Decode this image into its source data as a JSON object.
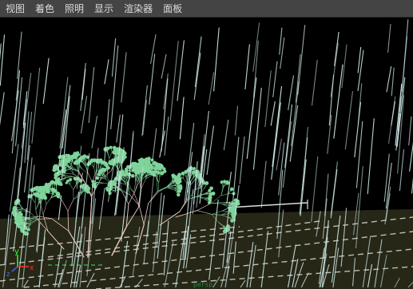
{
  "menu": {
    "items": [
      {
        "label": "视图"
      },
      {
        "label": "着色"
      },
      {
        "label": "照明"
      },
      {
        "label": "显示"
      },
      {
        "label": "渲染器"
      },
      {
        "label": "面板"
      }
    ]
  },
  "viewport": {
    "axis_icon": {
      "y_label": "y",
      "x_label": "x",
      "z_label": "z"
    },
    "colors": {
      "background": "#000000",
      "ground": "#2a2a1a",
      "rain": "#c8e4e0",
      "foliage": "#7fd49a",
      "branches": "#e8c8c0",
      "axis_x": "#ff3030",
      "axis_y": "#30ff30",
      "axis_z": "#4060ff"
    },
    "status_text": "persp"
  }
}
